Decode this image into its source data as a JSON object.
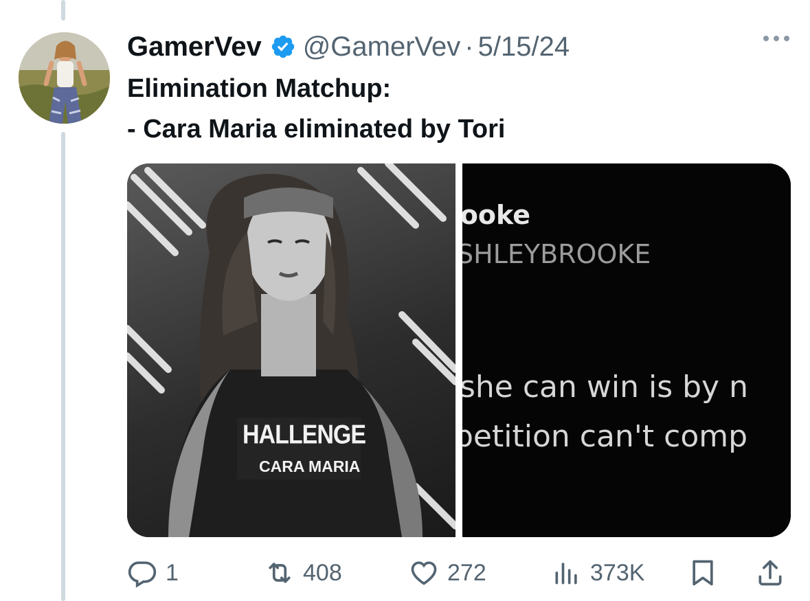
{
  "tweet": {
    "author_name": "GamerVev",
    "handle": "@GamerVev",
    "separator": "·",
    "date": "5/15/24",
    "verified": true,
    "text_lines": [
      "Elimination Matchup:",
      "- Cara Maria eliminated by Tori"
    ]
  },
  "media": {
    "left_image": {
      "shirt_line_1": "HALLENGE",
      "shirt_line_2": "CARA MARIA"
    },
    "right_image": {
      "name_fragment": "rooke",
      "handle_fragment": "SHLEYBROOKE",
      "line_1": "she can win is by n",
      "line_2": "petition can't comp"
    }
  },
  "actions": {
    "replies": "1",
    "reposts": "408",
    "likes": "272",
    "views": "373K"
  },
  "icons": {
    "verified": "verified-badge-icon",
    "more": "more-dots-icon",
    "reply": "reply-icon",
    "repost": "repost-icon",
    "like": "heart-icon",
    "views": "views-bar-chart-icon",
    "bookmark": "bookmark-icon",
    "share": "share-icon"
  },
  "colors": {
    "text": "#0f1419",
    "secondary": "#536471",
    "verified": "#1d9bf0",
    "thread_line": "#cfd9de"
  }
}
